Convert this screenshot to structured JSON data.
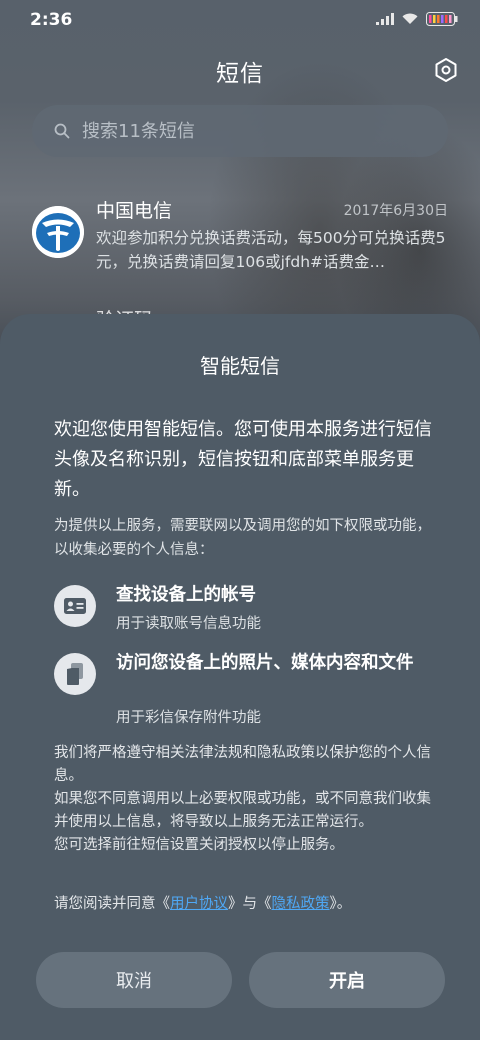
{
  "status_bar": {
    "time": "2:36"
  },
  "app_bar": {
    "title": "短信",
    "settings_icon": "settings-hexagon-icon"
  },
  "search": {
    "placeholder": "搜索11条短信"
  },
  "messages": [
    {
      "sender": "中国电信",
      "date": "2017年6月30日",
      "preview": "欢迎参加积分兑换话费活动，每500分可兑换话费5元，兑换话费请回复106或jfdh#话费金…"
    },
    {
      "sender": "验证码"
    }
  ],
  "dialog": {
    "title": "智能短信",
    "intro": "欢迎您使用智能短信。您可使用本服务进行短信头像及名称识别，短信按钮和底部菜单服务更新。",
    "permissions_desc": "为提供以上服务，需要联网以及调用您的如下权限或功能，以收集必要的个人信息：",
    "permissions": [
      {
        "icon": "id-card-icon",
        "title": "查找设备上的帐号",
        "sub": "用于读取账号信息功能"
      },
      {
        "icon": "files-icon",
        "title": "访问您设备上的照片、媒体内容和文件",
        "sub": "用于彩信保存附件功能"
      }
    ],
    "policy": "我们将严格遵守相关法律法规和隐私政策以保护您的个人信息。\n如果您不同意调用以上必要权限或功能，或不同意我们收集并使用以上信息，将导致以上服务无法正常运行。\n您可选择前往短信设置关闭授权以停止服务。",
    "agree_prefix": "请您阅读并同意《",
    "user_agreement": "用户协议",
    "agree_middle": "》与《",
    "privacy_policy": "隐私政策",
    "agree_suffix": "》。",
    "cancel_label": "取消",
    "ok_label": "开启"
  },
  "colors": {
    "link": "#4fa8f5",
    "sheet": "#4f5b66",
    "button": "#66727d"
  }
}
